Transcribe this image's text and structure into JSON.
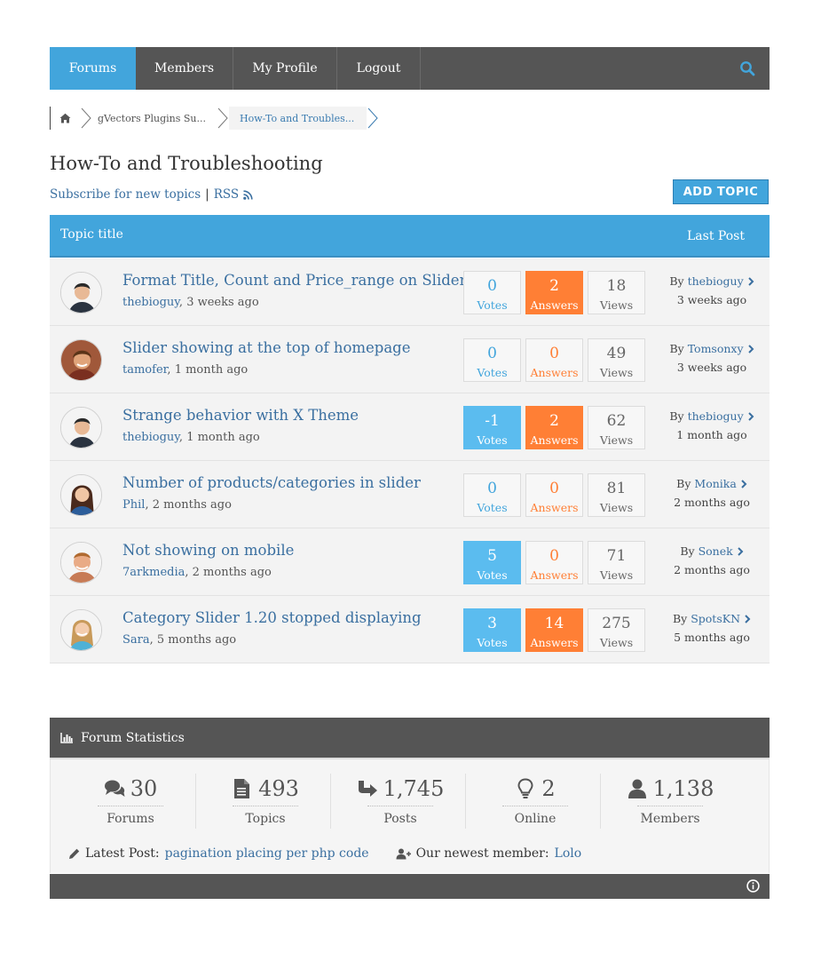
{
  "nav": {
    "items": [
      {
        "label": "Forums",
        "active": true
      },
      {
        "label": "Members"
      },
      {
        "label": "My Profile"
      },
      {
        "label": "Logout"
      }
    ],
    "search_icon": "search-icon"
  },
  "breadcrumb": {
    "home_icon": "home-icon",
    "items": [
      "gVectors Plugins Su...",
      "How-To and Troubles..."
    ]
  },
  "page": {
    "title": "How-To and Troubleshooting",
    "subscribe_label": "Subscribe for new topics",
    "separator": "|",
    "rss_label": "RSS",
    "add_topic_label": "ADD TOPIC"
  },
  "table": {
    "col_title": "Topic title",
    "col_last": "Last Post",
    "vote_label": "Votes",
    "answer_label": "Answers",
    "view_label": "Views",
    "by_label": "By",
    "topics": [
      {
        "title": "Format Title, Count and Price_range on Slider?",
        "author": "thebioguy",
        "time": "3 weeks ago",
        "votes": "0",
        "answers": "2",
        "views": "18",
        "last_by": "thebioguy",
        "last_time": "3 weeks ago"
      },
      {
        "title": "Slider showing at the top of homepage",
        "author": "tamofer",
        "time": "1 month ago",
        "votes": "0",
        "answers": "0",
        "views": "49",
        "last_by": "Tomsonxy",
        "last_time": "3 weeks ago"
      },
      {
        "title": "Strange behavior with X Theme",
        "author": "thebioguy",
        "time": "1 month ago",
        "votes": "-1",
        "answers": "2",
        "views": "62",
        "last_by": "thebioguy",
        "last_time": "1 month ago"
      },
      {
        "title": "Number of products/categories in slider",
        "author": "Phil",
        "time": "2 months ago",
        "votes": "0",
        "answers": "0",
        "views": "81",
        "last_by": "Monika",
        "last_time": "2 months ago"
      },
      {
        "title": "Not showing on mobile",
        "author": "7arkmedia",
        "time": "2 months ago",
        "votes": "5",
        "answers": "0",
        "views": "71",
        "last_by": "Sonek",
        "last_time": "2 months ago"
      },
      {
        "title": "Category Slider 1.20 stopped displaying",
        "author": "Sara",
        "time": "5 months ago",
        "votes": "3",
        "answers": "14",
        "views": "275",
        "last_by": "SpotsKN",
        "last_time": "5 months ago"
      }
    ]
  },
  "statistics": {
    "title": "Forum Statistics",
    "items": [
      {
        "value": "30",
        "label": "Forums",
        "icon": "comments-icon"
      },
      {
        "value": "493",
        "label": "Topics",
        "icon": "document-icon"
      },
      {
        "value": "1,745",
        "label": "Posts",
        "icon": "reply-arrow-icon"
      },
      {
        "value": "2",
        "label": "Online",
        "icon": "lightbulb-icon"
      },
      {
        "value": "1,138",
        "label": "Members",
        "icon": "user-icon"
      }
    ],
    "latest_post_label": "Latest Post:",
    "latest_post_link": "pagination placing per php code",
    "newest_member_label": "Our newest member:",
    "newest_member": "Lolo"
  },
  "colors": {
    "accent": "#42a5dc",
    "orange": "#ff7f35",
    "nav_dark": "#555555",
    "link": "#3a6fa0"
  }
}
